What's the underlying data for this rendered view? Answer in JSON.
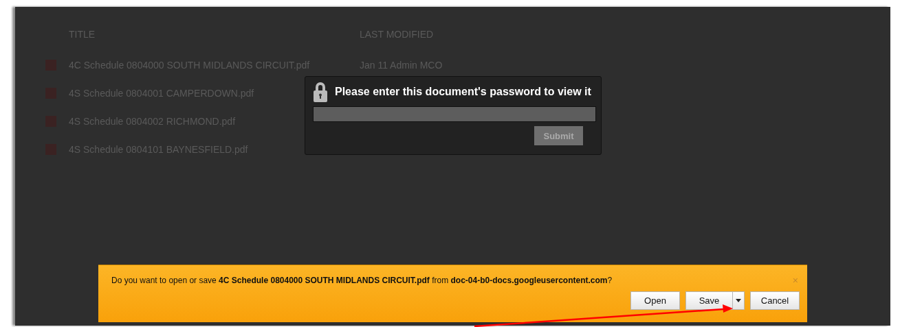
{
  "file_list": {
    "columns": [
      "TITLE",
      "LAST MODIFIED"
    ],
    "rows": [
      {
        "title": "4C Schedule 0804000 SOUTH MIDLANDS CIRCUIT.pdf",
        "modified": "Jan 11 Admin MCO"
      },
      {
        "title": "4S Schedule 0804001 CAMPERDOWN.pdf"
      },
      {
        "title": "4S Schedule 0804002 RICHMOND.pdf"
      },
      {
        "title": "4S Schedule 0804101 BAYNESFIELD.pdf"
      }
    ]
  },
  "password_dialog": {
    "title": "Please enter this document's password to view it",
    "button": "Submit"
  },
  "download_bar": {
    "message": "Do you want to open or save **4C Schedule 0804000 SOUTH MIDLANDS CIRCUIT.pdf** from **doc-04-b0-docs.googleusercontent.com**?",
    "close": "×",
    "buttons": [
      "Open",
      "Save",
      "Cancel"
    ]
  }
}
